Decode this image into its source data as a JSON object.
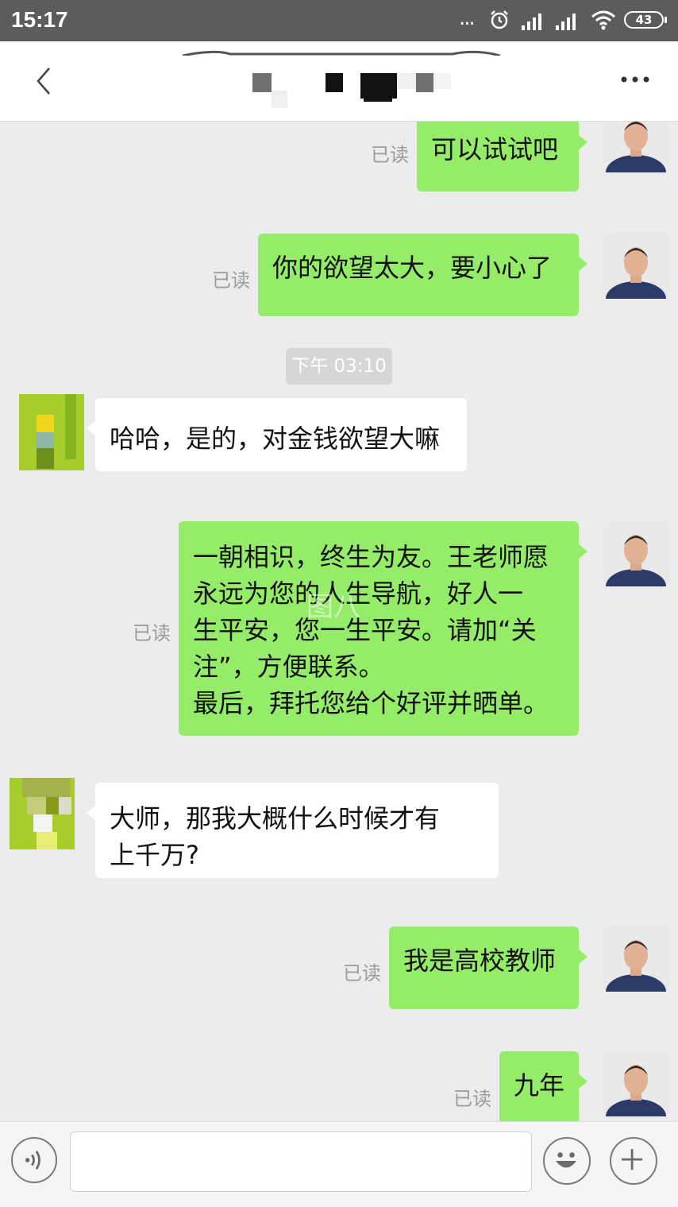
{
  "status_bar": {
    "time": "15:17",
    "more_indicator": "...",
    "battery_level": "43",
    "icons": [
      "alarm-icon",
      "signal-icon",
      "signal-icon",
      "wifi-icon",
      "battery-icon"
    ]
  },
  "header": {
    "back_icon": "chevron-left-icon",
    "more_icon": "more-dots-icon",
    "title_obscured": true
  },
  "messages": [
    {
      "from": "me",
      "text": "可以试试吧",
      "read_label": "已读"
    },
    {
      "from": "me",
      "text": "你的欲望太大，要小心了",
      "read_label": "已读"
    },
    {
      "type": "timestamp",
      "text": "下午 03:10"
    },
    {
      "from": "them",
      "text": "哈哈，是的，对金钱欲望大嘛"
    },
    {
      "from": "me",
      "lines": [
        "一朝相识，终生为友。王老师愿",
        "永远为您的人生导航，好人一",
        "生平安，您一生平安。请加“关",
        "注”，方便联系。",
        "最后，拜托您给个好评并晒单。"
      ],
      "read_label": "已读"
    },
    {
      "from": "them",
      "lines": [
        "大师，那我大概什么时候才有",
        "上千万?"
      ]
    },
    {
      "from": "me",
      "text": "我是高校教师",
      "read_label": "已读"
    },
    {
      "from": "me",
      "text": "九年",
      "read_label": "已读"
    }
  ],
  "watermark": "图八",
  "input_bar": {
    "voice_icon": "voice-icon",
    "text_value": "",
    "emoji_icon": "emoji-icon",
    "plus_icon": "plus-icon"
  },
  "colors": {
    "my_bubble": "#95ec69",
    "their_bubble": "#ffffff",
    "chat_background": "#ececec",
    "status_bar": "#5c5c5c"
  }
}
